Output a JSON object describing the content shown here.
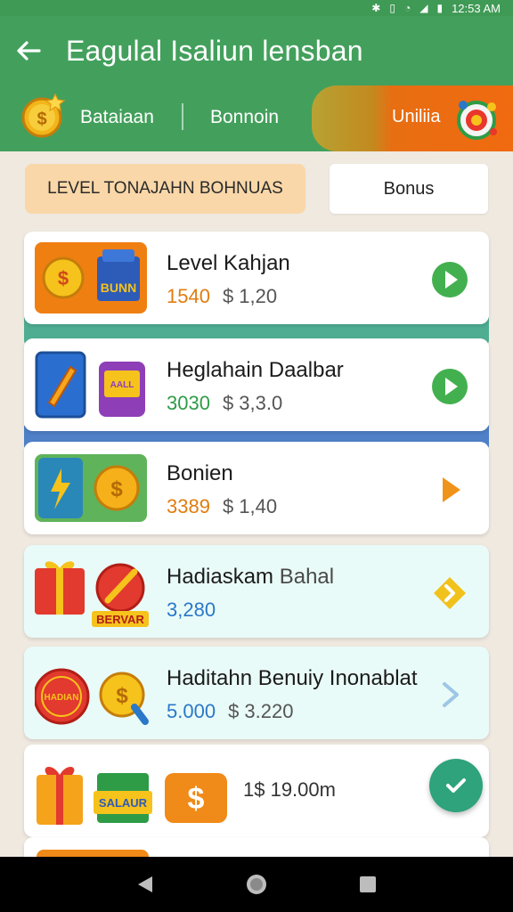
{
  "status_bar": {
    "time": "12:53 AM",
    "icons": [
      "bluetooth-icon",
      "vibrate-icon",
      "alarm-icon",
      "signal-icon",
      "battery-icon"
    ]
  },
  "app_bar": {
    "title": "Eagulal Isaliun lensban"
  },
  "tabs": [
    {
      "label": "Bataiaan"
    },
    {
      "label": "Bonnoin"
    },
    {
      "label": "Uniliia"
    }
  ],
  "filters": {
    "level_label": "LEVEL TONAJAHN BOHNUAS",
    "bonus_label": "Bonus"
  },
  "list": [
    {
      "title": "Level Kahjan",
      "title_muted": "",
      "value_a": "1540",
      "value_a_color": "#e07d10",
      "value_b": "$ 1,20",
      "action": "play-icon",
      "action_color": "#43b04f",
      "style": "white",
      "art_text": "BUNN"
    },
    {
      "title": "Heglahain Daalbar",
      "title_muted": "",
      "value_a": "3030",
      "value_a_color": "#2e9c47",
      "value_b": "$ 3,3.0",
      "action": "play-icon",
      "action_color": "#43b04f",
      "style": "white",
      "art_text": "AALL"
    },
    {
      "title": "Bonien",
      "title_muted": "",
      "value_a": "3389",
      "value_a_color": "#e07d10",
      "value_b": "$ 1,40",
      "action": "chevron-right-icon",
      "action_color": "#f0931a",
      "style": "white",
      "art_text": ""
    },
    {
      "title": "Hadiaskam",
      "title_muted": "Bahal",
      "value_a": "3,280",
      "value_a_color": "#2a78c8",
      "value_b": "",
      "action": "diamond-chevron-icon",
      "action_color": "#f1c21b",
      "style": "mint",
      "art_text": "BERVAR"
    },
    {
      "title": "Haditahn Benuiy Inonablat",
      "title_muted": "",
      "value_a": "5.000",
      "value_a_color": "#2a78c8",
      "value_b": "$ 3.220",
      "action": "chevron-right-icon",
      "action_color": "#9ec6e6",
      "style": "mint",
      "art_text": "HADIAN"
    },
    {
      "title": "",
      "title_muted": "",
      "value_a": "",
      "value_a_color": "#333333",
      "value_b": "1$ 19.00m",
      "action": "",
      "action_color": "",
      "style": "white",
      "art_text": "SALAUR"
    }
  ],
  "fab": {
    "icon": "check-icon",
    "color": "#2fa37b"
  },
  "nav": {
    "icons": [
      "back-triangle-icon",
      "home-circle-icon",
      "recents-square-icon"
    ]
  }
}
